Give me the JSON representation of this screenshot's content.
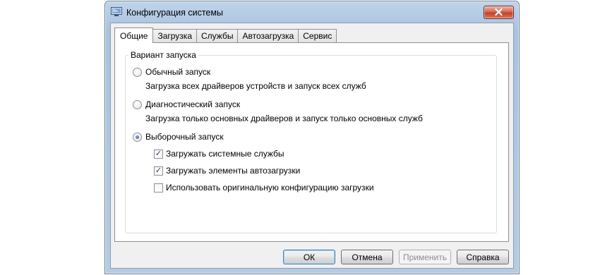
{
  "window": {
    "title": "Конфигурация системы",
    "icon": "msconfig-icon",
    "close_icon": "close-icon"
  },
  "tabs": [
    {
      "label": "Общие",
      "active": true
    },
    {
      "label": "Загрузка",
      "active": false
    },
    {
      "label": "Службы",
      "active": false
    },
    {
      "label": "Автозагрузка",
      "active": false
    },
    {
      "label": "Сервис",
      "active": false
    }
  ],
  "startup": {
    "legend": "Вариант запуска",
    "options": [
      {
        "label": "Обычный запуск",
        "description": "Загрузка всех драйверов устройств и запуск всех служб",
        "checked": false
      },
      {
        "label": "Диагностический запуск",
        "description": "Загрузка только основных драйверов и запуск только основных служб",
        "checked": false
      },
      {
        "label": "Выборочный запуск",
        "checked": true
      }
    ],
    "checkboxes": [
      {
        "label": "Загружать системные службы",
        "checked": true
      },
      {
        "label": "Загружать элементы автозагрузки",
        "checked": true
      },
      {
        "label": "Использовать оригинальную конфигурацию загрузки",
        "checked": false
      }
    ]
  },
  "buttons": {
    "ok": "ОК",
    "cancel": "Отмена",
    "apply": "Применить",
    "help": "Справка"
  },
  "colors": {
    "title_bar": "#b4cbe4",
    "close_button": "#c2412a",
    "default_button_border": "#3c7fb1"
  }
}
